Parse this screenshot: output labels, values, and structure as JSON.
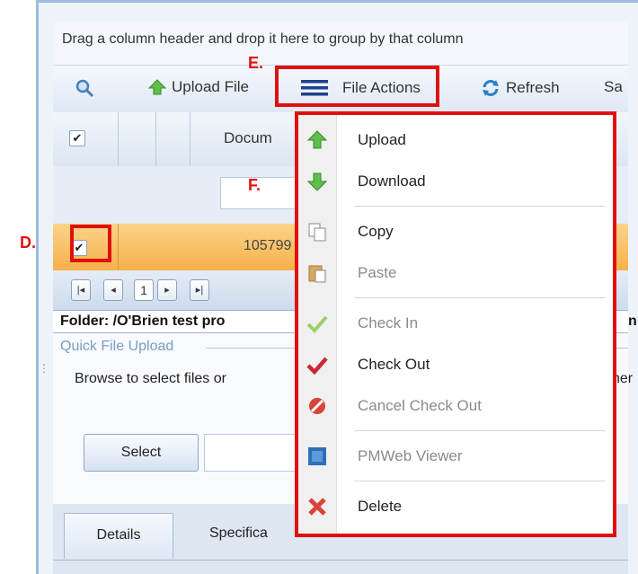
{
  "group_panel": {
    "text": "Drag a column header and drop it here to group by that column"
  },
  "toolbar": {
    "search_icon": "magnifier-icon",
    "upload_label": "Upload File",
    "file_actions_label": "File Actions",
    "refresh_label": "Refresh",
    "save_label_partial": "Sa"
  },
  "grid": {
    "header_doc_col": "Docum",
    "row1_value": "105799",
    "row1_checked": true
  },
  "pager": {
    "first": "|◂",
    "prev": "◂",
    "page": "1",
    "next": "▸",
    "last": "▸|"
  },
  "folder_label": "Folder: /O'Brien test pro",
  "folder_label_tail": "n C",
  "quick_upload": {
    "legend": "Quick File Upload",
    "instruction": "Browse to select files or",
    "instruction_tail": "her",
    "select_label": "Select"
  },
  "tabs": {
    "details": "Details",
    "specifica": "Specifica"
  },
  "annotations": {
    "d": "D.",
    "e": "E.",
    "f": "F."
  },
  "file_actions_menu": {
    "items": [
      {
        "label": "Upload",
        "icon": "arrow-up-green-icon",
        "enabled": true
      },
      {
        "label": "Download",
        "icon": "arrow-down-green-icon",
        "enabled": true
      },
      {
        "label": "Copy",
        "icon": "copy-icon",
        "enabled": true
      },
      {
        "label": "Paste",
        "icon": "paste-icon",
        "enabled": false
      },
      {
        "label": "Check In",
        "icon": "checkmark-green-icon",
        "enabled": false
      },
      {
        "label": "Check Out",
        "icon": "checkmark-red-icon",
        "enabled": true
      },
      {
        "label": "Cancel Check Out",
        "icon": "cancel-circle-icon",
        "enabled": false
      },
      {
        "label": "PMWeb Viewer",
        "icon": "viewer-icon",
        "enabled": false
      },
      {
        "label": "Delete",
        "icon": "delete-x-icon",
        "enabled": true
      }
    ]
  },
  "colors": {
    "highlight": "#e01010",
    "selected_row": "#f6b04a",
    "accent_blue": "#9ebbe0"
  }
}
